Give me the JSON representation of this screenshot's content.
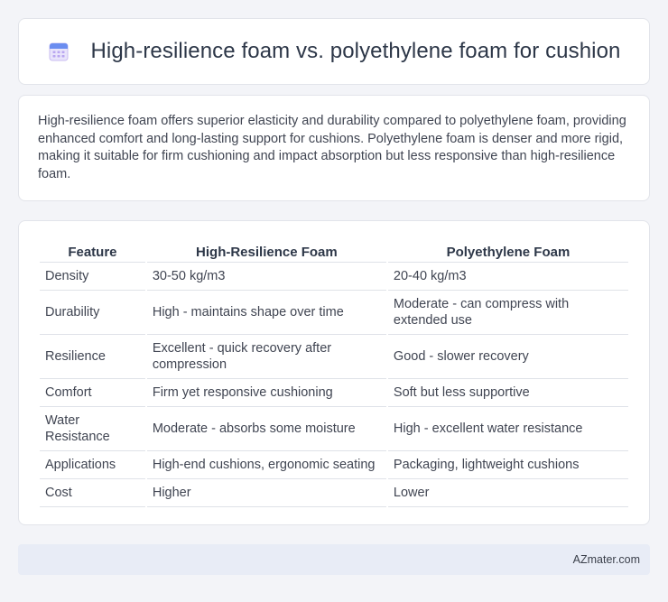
{
  "header": {
    "title": "High-resilience foam vs. polyethylene foam for cushion",
    "icon": "calendar-icon"
  },
  "description": "High-resilience foam offers superior elasticity and durability compared to polyethylene foam, providing enhanced comfort and long-lasting support for cushions. Polyethylene foam is denser and more rigid, making it suitable for firm cushioning and impact absorption but less responsive than high-resilience foam.",
  "table": {
    "headers": [
      "Feature",
      "High-Resilience Foam",
      "Polyethylene Foam"
    ],
    "rows": [
      [
        "Density",
        "30-50 kg/m3",
        "20-40 kg/m3"
      ],
      [
        "Durability",
        "High - maintains shape over time",
        "Moderate - can compress with extended use"
      ],
      [
        "Resilience",
        "Excellent - quick recovery after compression",
        "Good - slower recovery"
      ],
      [
        "Comfort",
        "Firm yet responsive cushioning",
        "Soft but less supportive"
      ],
      [
        "Water Resistance",
        "Moderate - absorbs some moisture",
        "High - excellent water resistance"
      ],
      [
        "Applications",
        "High-end cushions, ergonomic seating",
        "Packaging, lightweight cushions"
      ],
      [
        "Cost",
        "Higher",
        "Lower"
      ]
    ]
  },
  "footer": {
    "brand": "AZmater.com"
  }
}
